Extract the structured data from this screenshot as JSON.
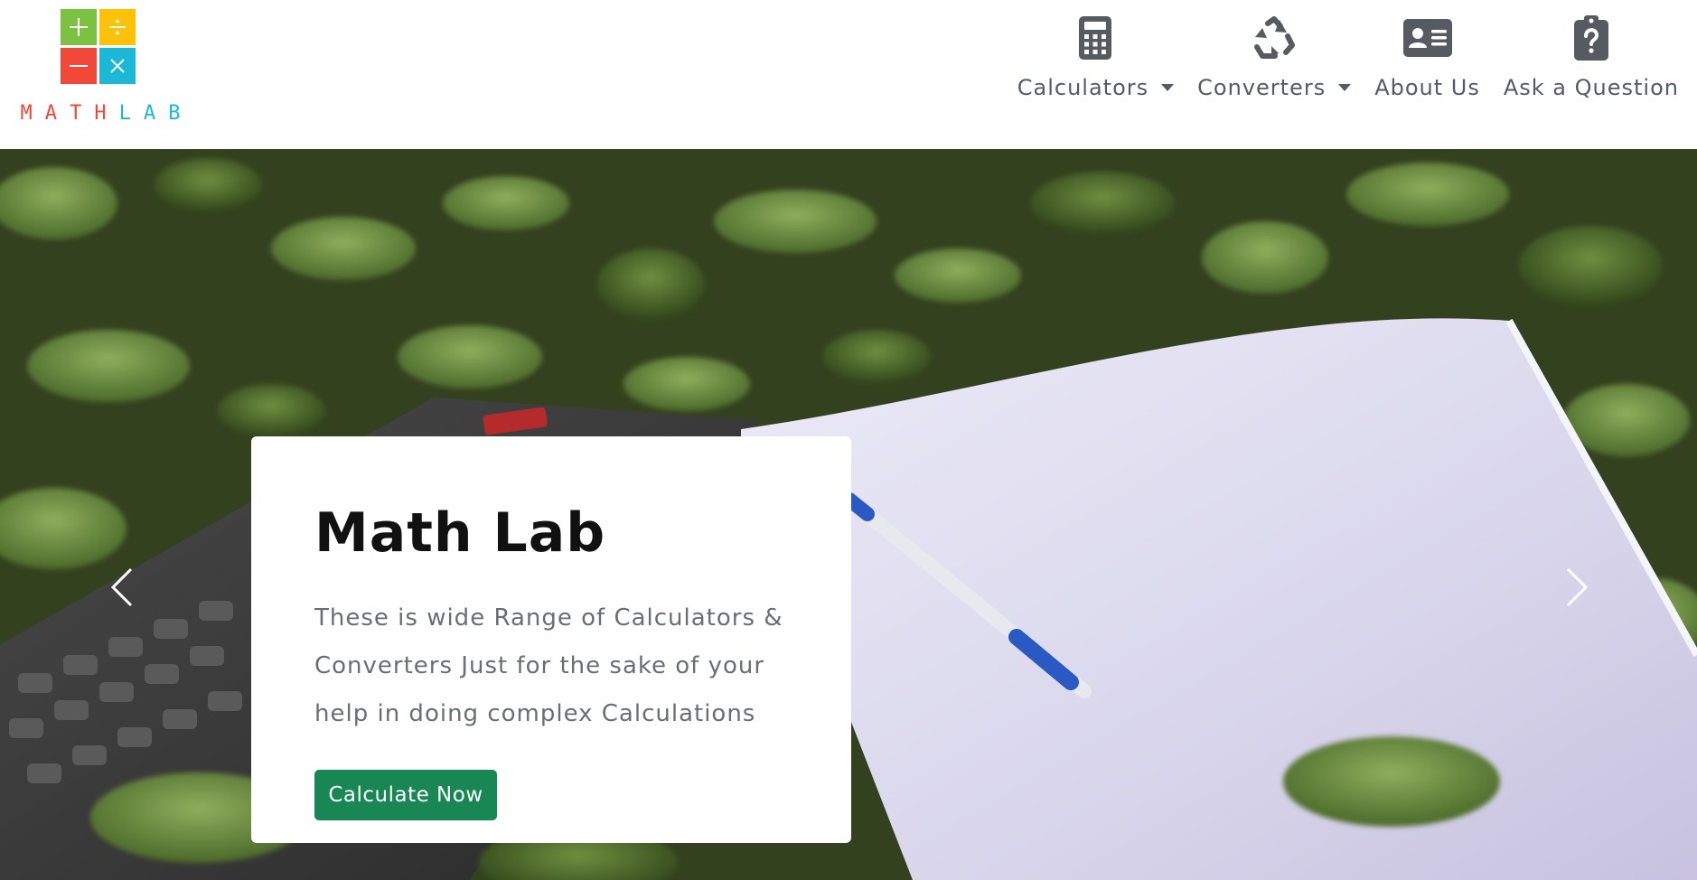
{
  "logo": {
    "cells": [
      {
        "symbol": "+",
        "color": "#7cc242"
      },
      {
        "symbol": "÷",
        "color": "#fcc20a"
      },
      {
        "symbol": "−",
        "color": "#f2483a"
      },
      {
        "symbol": "×",
        "color": "#1cb8d8"
      }
    ],
    "letters": [
      {
        "char": "M",
        "color": "#f2483a"
      },
      {
        "char": "A",
        "color": "#f2483a"
      },
      {
        "char": "T",
        "color": "#f2483a"
      },
      {
        "char": "H",
        "color": "#f2483a"
      },
      {
        "char": "L",
        "color": "#1cb8d8"
      },
      {
        "char": "A",
        "color": "#1cb8d8"
      },
      {
        "char": "B",
        "color": "#1cb8d8"
      }
    ]
  },
  "nav": {
    "calculators": {
      "label": "Calculators",
      "icon": "calculator-icon",
      "has_dropdown": true
    },
    "converters": {
      "label": "Converters",
      "icon": "recycle-icon",
      "has_dropdown": true
    },
    "about": {
      "label": "About Us",
      "icon": "id-card-icon",
      "has_dropdown": false
    },
    "ask": {
      "label": "Ask a Question",
      "icon": "clipboard-question-icon",
      "has_dropdown": false
    }
  },
  "hero": {
    "title": "Math Lab",
    "text": "These is wide Range of Calculators & Converters Just for the sake of your help in doing complex Calculations",
    "cta_label": "Calculate Now",
    "prev_icon": "chevron-left-icon",
    "next_icon": "chevron-right-icon"
  },
  "colors": {
    "nav_text": "#555b60",
    "cta_bg": "#198754",
    "body_text": "#6b6e71"
  }
}
